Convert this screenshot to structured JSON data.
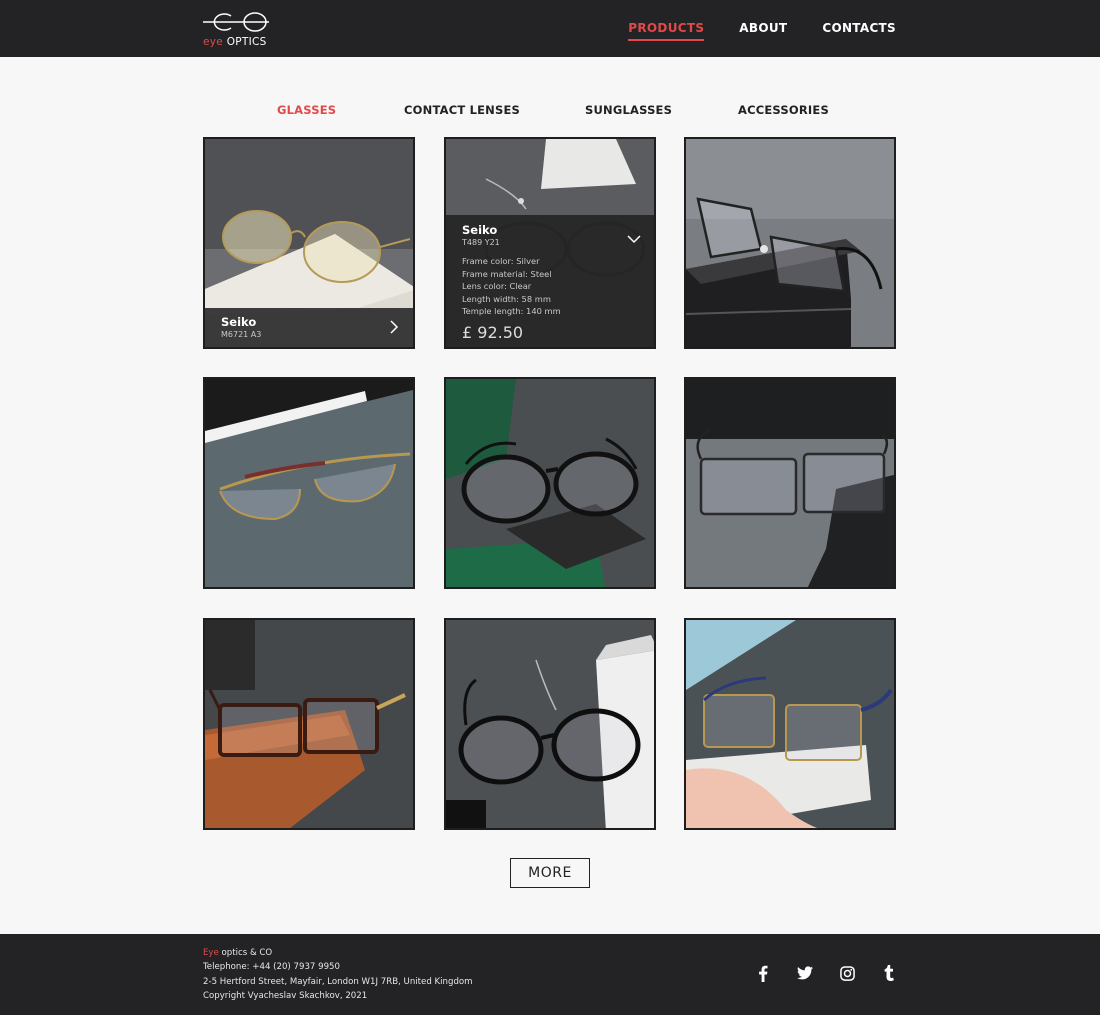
{
  "header": {
    "logo": {
      "eye": "eye",
      "optics": "OPTICS"
    },
    "nav": [
      {
        "label": "PRODUCTS",
        "active": true
      },
      {
        "label": "ABOUT",
        "active": false
      },
      {
        "label": "CONTACTS",
        "active": false
      }
    ],
    "accent_color": "#e04a4a",
    "bar_color": "#232325"
  },
  "categories": [
    {
      "label": "GLASSES",
      "active": true
    },
    {
      "label": "CONTACT LENSES",
      "active": false
    },
    {
      "label": "SUNGLASSES",
      "active": false
    },
    {
      "label": "ACCESSORIES",
      "active": false
    }
  ],
  "products": [
    {
      "brand": "Seiko",
      "model": "M6721 A3",
      "state": "label",
      "icon": "chevron-right-icon"
    },
    {
      "brand": "Seiko",
      "model": "T489 Y21",
      "state": "expanded",
      "icon": "chevron-down-icon",
      "details": [
        "Frame color: Silver",
        "Frame material: Steel",
        "Lens color: Clear",
        "Length width: 58 mm",
        "Temple length: 140 mm"
      ],
      "price": "£ 92.50"
    },
    {
      "state": "image"
    },
    {
      "state": "image"
    },
    {
      "state": "image"
    },
    {
      "state": "image"
    },
    {
      "state": "image"
    },
    {
      "state": "image"
    },
    {
      "state": "image"
    }
  ],
  "more_button": "MORE",
  "footer": {
    "brand_accent": "Eye",
    "brand_rest": " optics & CO",
    "telephone": "Telephone: +44 (20) 7937 9950",
    "address": "2-5 Hertford Street, Mayfair, London W1J 7RB, United Kingdom",
    "copyright": "Copyright Vyacheslav Skachkov, 2021",
    "socials": [
      "facebook-icon",
      "twitter-icon",
      "instagram-icon",
      "tumblr-icon"
    ]
  }
}
